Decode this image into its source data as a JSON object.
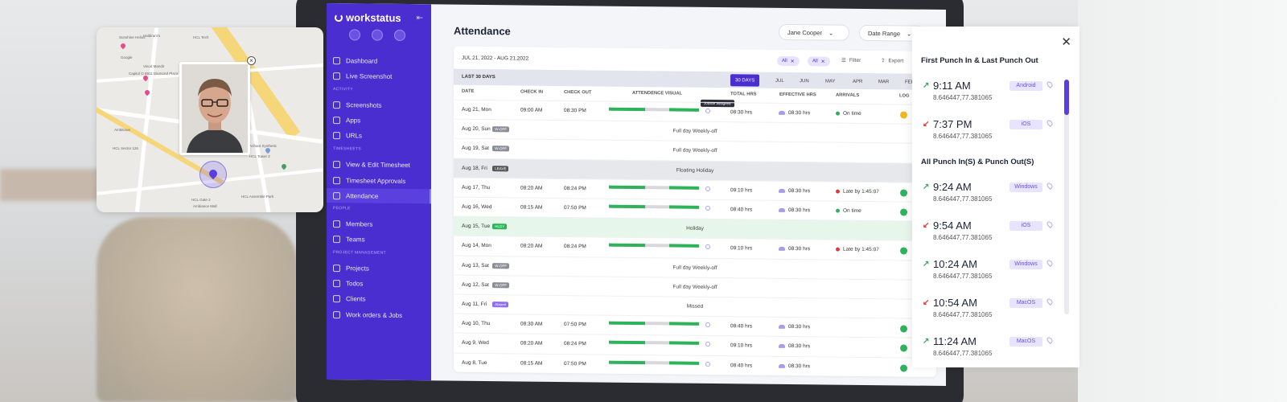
{
  "sidebar": {
    "logo": "workstatus",
    "sections": {
      "activity": "ACTIVITY",
      "timesheets": "TIMESHEETS",
      "people": "PEOPLE",
      "project": "PROJECT MANAGEMENT"
    },
    "items": [
      "Dashboard",
      "Live Screenshot",
      "Screenshots",
      "Apps",
      "URLs",
      "View & Edit Timesheet",
      "Timesheet Approvals",
      "Attendance",
      "Members",
      "Teams",
      "Projects",
      "Todos",
      "Clients",
      "Work orders & Jobs"
    ]
  },
  "header": {
    "title": "Attendance",
    "user_filter": "Jane Cooper",
    "date_range": "Date Range"
  },
  "card": {
    "date_span": "JUL 21, 2022 - AUG 21,2022",
    "chips": [
      "All",
      "All"
    ],
    "filter": "Filter",
    "export": "Export",
    "range_label": "LAST 30 DAYS",
    "range_tabs": [
      "30 DAYS",
      "JUL",
      "JUN",
      "MAY",
      "APR",
      "MAR",
      "FEB"
    ],
    "columns": [
      "DATE",
      "CHECK IN",
      "CHECK OUT",
      "ATTENDENCE VISUAL",
      "TOTAL HRS",
      "EFFECTIVE HRS",
      "ARRIVALS",
      "LOG"
    ],
    "tooltip": "Jobsite assigned",
    "rows": [
      {
        "date": "Aug 21, Mon",
        "in": "09:00 AM",
        "out": "08:30 PM",
        "total": "08:30 hrs",
        "eff": "08:30 hrs",
        "arrival": "On time"
      },
      {
        "date": "Aug 20, Sun",
        "badge": "W-OFF",
        "msg": "Full day Weekly-off"
      },
      {
        "date": "Aug 19, Sat",
        "badge": "W-OFF",
        "msg": "Full day Weekly-off"
      },
      {
        "date": "Aug 18, Fri",
        "badge": "LEAVE",
        "msg": "Floating Holiday"
      },
      {
        "date": "Aug 17, Thu",
        "in": "08:20 AM",
        "out": "08:24 PM",
        "total": "09:10 hrs",
        "eff": "08:30 hrs",
        "arrival": "Late by 1:45:07"
      },
      {
        "date": "Aug 16, Wed",
        "in": "08:15 AM",
        "out": "07:50 PM",
        "total": "08:40 hrs",
        "eff": "08:30 hrs",
        "arrival": "On time"
      },
      {
        "date": "Aug 15, Tue",
        "badge": "HLDY",
        "msg": "Holiday"
      },
      {
        "date": "Aug 14, Mon",
        "in": "08:20 AM",
        "out": "08:24 PM",
        "total": "09:10 hrs",
        "eff": "08:30 hrs",
        "arrival": "Late by 1:45:07"
      },
      {
        "date": "Aug 13, Sat",
        "badge": "W-OFF",
        "msg": "Full day Weekly-off"
      },
      {
        "date": "Aug 12, Sat",
        "badge": "W-OFF",
        "msg": "Full day Weekly-off"
      },
      {
        "date": "Aug 11, Fri",
        "badge": "Absent",
        "msg": "Missed"
      },
      {
        "date": "Aug 10, Thu",
        "in": "08:30 AM",
        "out": "07:50 PM",
        "total": "08:40 hrs",
        "eff": "08:30 hrs"
      },
      {
        "date": "Aug 9, Wed",
        "in": "08:20 AM",
        "out": "08:24 PM",
        "total": "09:10 hrs",
        "eff": "08:30 hrs"
      },
      {
        "date": "Aug 8, Tue",
        "in": "08:15 AM",
        "out": "07:50 PM",
        "total": "08:40 hrs",
        "eff": "08:30 hrs"
      }
    ]
  },
  "panel": {
    "first_title": "First Punch In & Last Punch Out",
    "all_title": "All Punch In(S) & Punch Out(S)",
    "first": [
      {
        "time": "9:11 AM",
        "coord": "8.646447,77.381065",
        "os": "Android",
        "dir": "in"
      },
      {
        "time": "7:37 PM",
        "coord": "8.646447,77.381065",
        "os": "iOS",
        "dir": "out"
      }
    ],
    "all": [
      {
        "time": "9:24 AM",
        "coord": "8.646447,77.381065",
        "os": "Windows",
        "dir": "in"
      },
      {
        "time": "9:54 AM",
        "coord": "8.646447,77.381065",
        "os": "iOS",
        "dir": "out"
      },
      {
        "time": "10:24 AM",
        "coord": "8.646447,77.381065",
        "os": "Windows",
        "dir": "in"
      },
      {
        "time": "10:54 AM",
        "coord": "8.646447,77.381065",
        "os": "MacOS",
        "dir": "out"
      },
      {
        "time": "11:24 AM",
        "coord": "8.646447,77.381065",
        "os": "MacOS",
        "dir": "in"
      }
    ]
  },
  "map": {
    "labels": [
      "Sunshine Helios",
      "Haldiram's",
      "Capitol O 8911 Diamond Plaza",
      "Vinod Mandir",
      "HCL Tech",
      "Google",
      "HCL Sector 126",
      "Ambitious",
      "Arihant Synthetic",
      "HCL Tower 2",
      "HCL Gate 2",
      "HCL Assemble Park",
      "Ambiance Mall"
    ]
  },
  "colors": {
    "brand": "#4a2ed0",
    "green": "#2eb35a",
    "red": "#e53935",
    "badge_gray": "#8b8d96",
    "badge_leave": "#555",
    "badge_hldy": "#2eb35a",
    "badge_absent": "#8f6bf2"
  }
}
